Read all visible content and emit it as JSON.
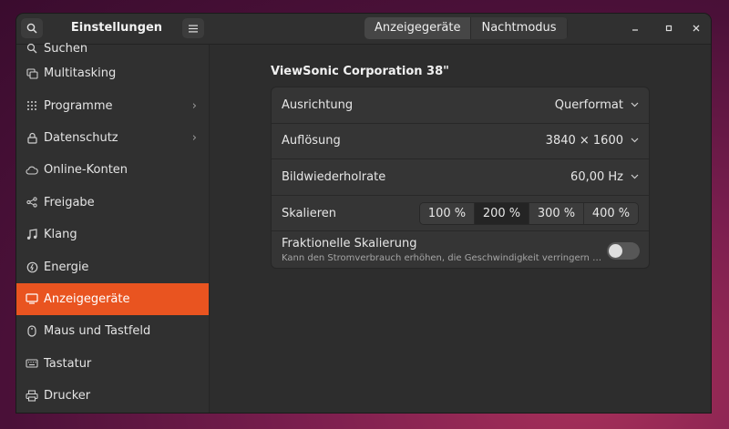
{
  "app_title": "Einstellungen",
  "tabs": [
    {
      "label": "Anzeigegeräte",
      "active": true
    },
    {
      "label": "Nachtmodus",
      "active": false
    }
  ],
  "sidebar": {
    "items": [
      {
        "label": "Suchen",
        "icon": "search-icon"
      },
      {
        "label": "Multitasking",
        "icon": "multitasking-icon"
      },
      {
        "label": "Programme",
        "icon": "apps-grid-icon",
        "chevron": "›"
      },
      {
        "label": "Datenschutz",
        "icon": "lock-icon",
        "chevron": "›"
      },
      {
        "label": "Online-Konten",
        "icon": "cloud-icon"
      },
      {
        "label": "Freigabe",
        "icon": "share-icon"
      },
      {
        "label": "Klang",
        "icon": "music-note-icon"
      },
      {
        "label": "Energie",
        "icon": "power-icon"
      },
      {
        "label": "Anzeigegeräte",
        "icon": "display-icon",
        "active": true
      },
      {
        "label": "Maus und Tastfeld",
        "icon": "mouse-icon"
      },
      {
        "label": "Tastatur",
        "icon": "keyboard-icon"
      },
      {
        "label": "Drucker",
        "icon": "printer-icon"
      }
    ]
  },
  "monitor": {
    "title": "ViewSonic Corporation 38\"",
    "orientation": {
      "label": "Ausrichtung",
      "value": "Querformat"
    },
    "resolution": {
      "label": "Auflösung",
      "value": "3840 × 1600"
    },
    "refresh_rate": {
      "label": "Bildwiederholrate",
      "value": "60,00 Hz"
    },
    "scale": {
      "label": "Skalieren",
      "options": [
        "100 %",
        "200 %",
        "300 %",
        "400 %"
      ],
      "selected": "200 %"
    },
    "fractional": {
      "label": "Fraktionelle Skalierung",
      "subtitle": "Kann den Stromverbrauch erhöhen, die Geschwindigkeit verringern …",
      "enabled": false
    }
  },
  "colors": {
    "accent": "#e95420"
  }
}
